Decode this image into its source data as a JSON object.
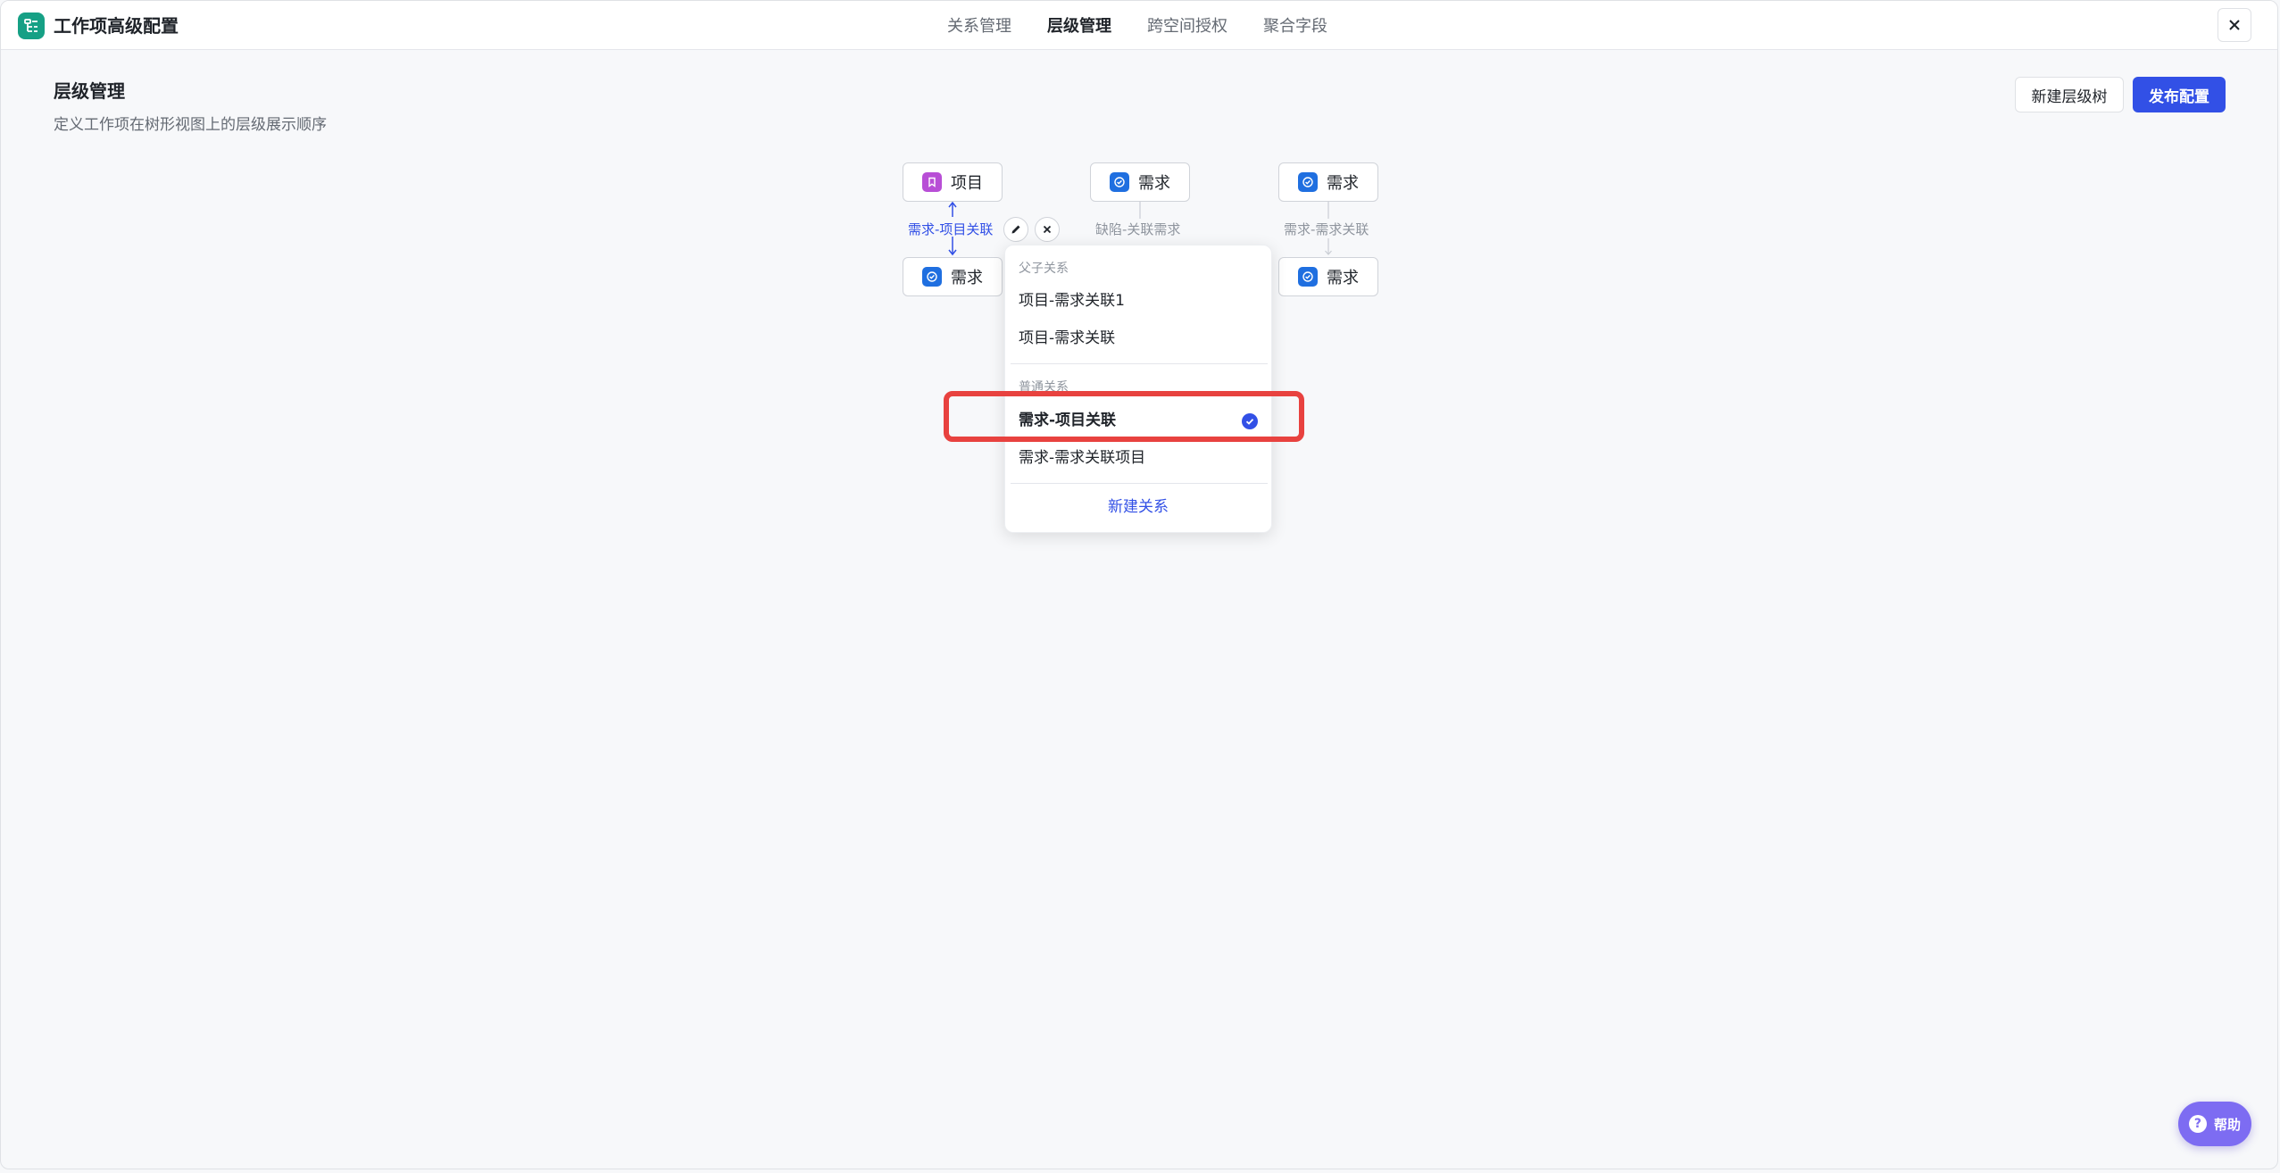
{
  "app": {
    "title": "工作项高级配置",
    "icon": "tree-config-icon",
    "accent": "#16a085"
  },
  "tabs": [
    {
      "label": "关系管理",
      "active": false
    },
    {
      "label": "层级管理",
      "active": true
    },
    {
      "label": "跨空间授权",
      "active": false
    },
    {
      "label": "聚合字段",
      "active": false
    }
  ],
  "page": {
    "title": "层级管理",
    "description": "定义工作项在树形视图上的层级展示顺序"
  },
  "actions": {
    "new_tree": "新建层级树",
    "publish": "发布配置",
    "primary_color": "#3250e6"
  },
  "trees": [
    {
      "parent": {
        "label": "项目",
        "icon": "bookmark-icon"
      },
      "relation": "需求-项目关联",
      "child": {
        "label": "需求",
        "icon": "requirement-icon"
      }
    },
    {
      "parent": {
        "label": "需求",
        "icon": "requirement-icon"
      },
      "relation": "缺陷-关联需求",
      "child": null
    },
    {
      "parent": {
        "label": "需求",
        "icon": "requirement-icon"
      },
      "relation": "需求-需求关联",
      "child": {
        "label": "需求",
        "icon": "requirement-icon"
      }
    }
  ],
  "dropdown": {
    "group_parent_child": "父子关系",
    "parent_child_items": [
      "项目-需求关联1",
      "项目-需求关联"
    ],
    "group_normal": "普通关系",
    "normal_items": [
      {
        "label": "需求-项目关联",
        "selected": true
      },
      {
        "label": "需求-需求关联项目",
        "selected": false
      }
    ],
    "new_relation": "新建关系"
  },
  "help": {
    "label": "帮助",
    "icon": "question-icon"
  }
}
